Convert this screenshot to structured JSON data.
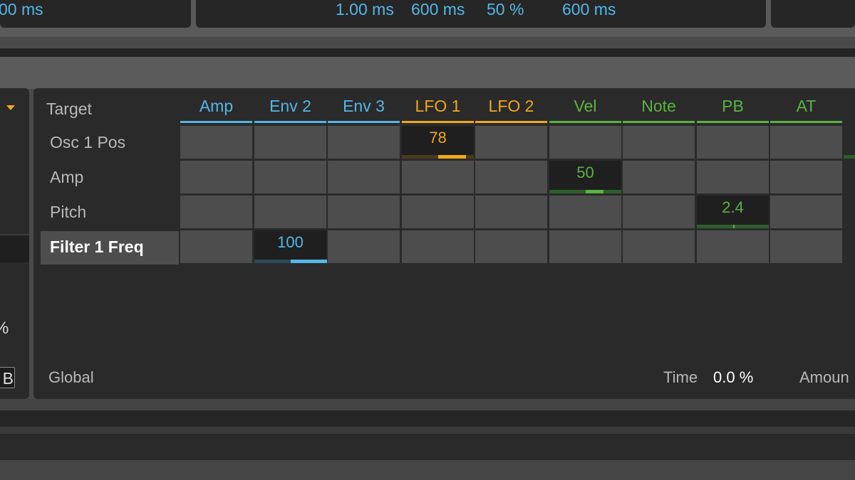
{
  "top_bar": {
    "left_value": "00 ms",
    "values": [
      "1.00 ms",
      "600 ms",
      "50 %",
      "600 ms"
    ]
  },
  "left_panel": {
    "percent_fragment": "%",
    "button_fragment": "B"
  },
  "matrix": {
    "target_header": "Target",
    "columns": [
      {
        "label": "Amp",
        "color": "#54b6e6"
      },
      {
        "label": "Env 2",
        "color": "#54b6e6"
      },
      {
        "label": "Env 3",
        "color": "#54b6e6"
      },
      {
        "label": "LFO 1",
        "color": "#f0a91b"
      },
      {
        "label": "LFO 2",
        "color": "#f0a91b"
      },
      {
        "label": "Vel",
        "color": "#5ab343"
      },
      {
        "label": "Note",
        "color": "#5ab343"
      },
      {
        "label": "PB",
        "color": "#5ab343"
      },
      {
        "label": "AT",
        "color": "#5ab343"
      }
    ],
    "rows": [
      "Osc 1 Pos",
      "Amp",
      "Pitch",
      "Filter 1 Freq"
    ],
    "selected_row": "Filter 1 Freq",
    "active_cells": [
      {
        "row": 0,
        "col": 3,
        "value": "78",
        "amount": 0.78,
        "color": "#f0a91b",
        "track_color": "#4a3a1a"
      },
      {
        "row": 1,
        "col": 5,
        "value": "50",
        "amount": 0.5,
        "color": "#5ab343",
        "track_color": "#2c5f2a"
      },
      {
        "row": 2,
        "col": 7,
        "value": "2.4",
        "amount": 0.024,
        "color": "#5ab343",
        "track_color": "#2c5f2a"
      },
      {
        "row": 3,
        "col": 1,
        "value": "100",
        "amount": 1.0,
        "color": "#54b6e6",
        "track_color": "#2c4a58"
      }
    ]
  },
  "footer": {
    "global_label": "Global",
    "time_label": "Time",
    "time_value": "0.0 %",
    "amount_label": "Amoun"
  },
  "colors": {
    "env": "#54b6e6",
    "lfo": "#f0a91b",
    "midi": "#5ab343"
  }
}
